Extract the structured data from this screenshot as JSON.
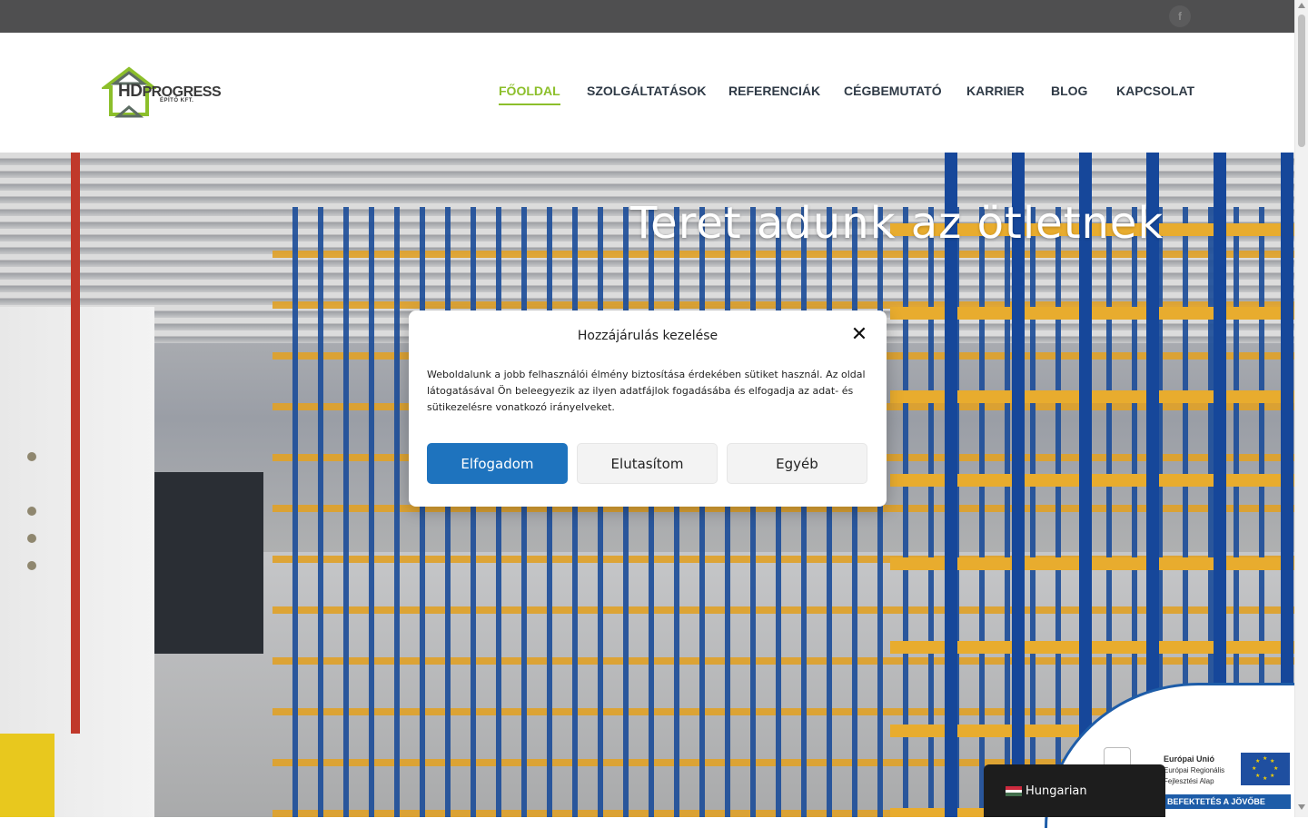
{
  "topbar": {
    "social_icon": "facebook-icon",
    "social_glyph": "f"
  },
  "logo": {
    "brand_main": "PROGRESS",
    "brand_hd": "HD",
    "brand_sub": "ÉPÍTŐ KFT.",
    "accent": "#8cbf2b"
  },
  "nav": {
    "items": [
      {
        "label": "FŐOLDAL",
        "active": true
      },
      {
        "label": "SZOLGÁLTATÁSOK",
        "active": false
      },
      {
        "label": "REFERENCIÁK",
        "active": false
      },
      {
        "label": "CÉGBEMUTATÓ",
        "active": false
      },
      {
        "label": "KARRIER",
        "active": false
      },
      {
        "label": "BLOG",
        "active": false
      },
      {
        "label": "KAPCSOLAT",
        "active": false
      }
    ],
    "active_color": "#8cbf2b",
    "text_color": "#2f3a46"
  },
  "hero": {
    "title": "Teret adunk az ötletnek"
  },
  "consent": {
    "title": "Hozzájárulás kezelése",
    "close_glyph": "✕",
    "text": "Weboldalunk a jobb felhasználói élmény biztosítása érdekében sütiket használ. Az oldal látogatásával Ön beleegyezik az ilyen adatfájlok fogadásába és elfogadja az adat- és sütikezelésre vonatkozó irányelveket.",
    "accept_label": "Elfogadom",
    "deny_label": "Elutasítom",
    "other_label": "Egyéb",
    "accept_color": "#1e73be"
  },
  "eu_badge": {
    "title": "Európai Unió",
    "sub1": "Európai Regionális",
    "sub2": "Fejlesztési Alap",
    "bar": "BEFEKTETÉS A JÖVŐBE",
    "color": "#1d5ca8"
  },
  "language": {
    "label": "Hungarian",
    "flag_icon": "hungary-flag-icon"
  }
}
